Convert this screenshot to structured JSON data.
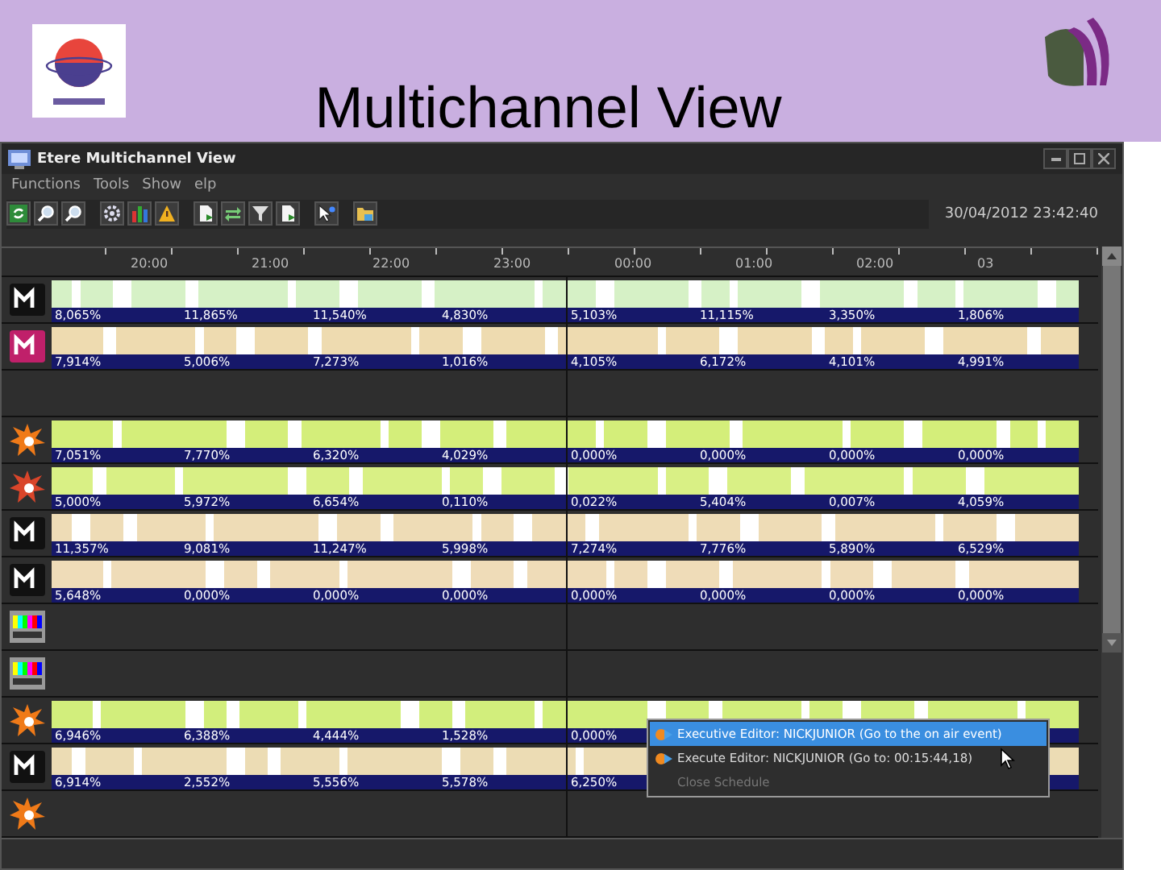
{
  "slide": {
    "title": "Multichannel View"
  },
  "window": {
    "title": "Etere Multichannel View"
  },
  "menu": [
    "Functions",
    "Tools",
    "Show",
    "elp"
  ],
  "toolbar": {
    "datetime": "30/04/2012 23:42:40"
  },
  "timeline": {
    "hours": [
      "20:00",
      "21:00",
      "22:00",
      "23:00",
      "00:00",
      "01:00",
      "02:00",
      "03"
    ]
  },
  "channels": [
    {
      "kind": "bar",
      "color": "#d6f1c6",
      "shares": [
        "8,065%",
        "11,865%",
        "11,540%",
        "4,830%",
        "5,103%",
        "11,115%",
        "3,350%",
        "1,806%"
      ]
    },
    {
      "kind": "bar",
      "color": "#eedbb0",
      "shares": [
        "7,914%",
        "5,006%",
        "7,273%",
        "1,016%",
        "4,105%",
        "6,172%",
        "4,101%",
        "4,991%"
      ]
    },
    {
      "kind": "empty"
    },
    {
      "kind": "bar",
      "color": "#d4ee7a",
      "shares": [
        "7,051%",
        "7,770%",
        "6,320%",
        "4,029%",
        "0,000%",
        "0,000%",
        "0,000%",
        "0,000%"
      ]
    },
    {
      "kind": "bar",
      "color": "#d9f085",
      "shares": [
        "5,000%",
        "5,972%",
        "6,654%",
        "0,110%",
        "0,022%",
        "5,404%",
        "0,007%",
        "4,059%"
      ]
    },
    {
      "kind": "bar",
      "color": "#eedcb6",
      "shares": [
        "11,357%",
        "9,081%",
        "11,247%",
        "5,998%",
        "7,274%",
        "7,776%",
        "5,890%",
        "6,529%"
      ]
    },
    {
      "kind": "bar",
      "color": "#efdcb8",
      "shares": [
        "5,648%",
        "0,000%",
        "0,000%",
        "0,000%",
        "0,000%",
        "0,000%",
        "0,000%",
        "0,000%"
      ]
    },
    {
      "kind": "empty"
    },
    {
      "kind": "empty"
    },
    {
      "kind": "bar",
      "color": "#d2ee7c",
      "shares": [
        "6,946%",
        "6,388%",
        "4,444%",
        "1,528%",
        "0,000%"
      ]
    },
    {
      "kind": "bar",
      "color": "#ecdcb4",
      "shares": [
        "6,914%",
        "2,552%",
        "5,556%",
        "5,578%",
        "6,250%"
      ]
    },
    {
      "kind": "empty"
    }
  ],
  "context_menu": {
    "items": [
      {
        "label": "Executive Editor: NICKJUNIOR (Go to the on air event)",
        "selected": true,
        "disabled": false
      },
      {
        "label": "Execute Editor: NICKJUNIOR (Go to: 00:15:44,18)",
        "selected": false,
        "disabled": false
      },
      {
        "label": "Close Schedule",
        "selected": false,
        "disabled": true
      }
    ]
  }
}
